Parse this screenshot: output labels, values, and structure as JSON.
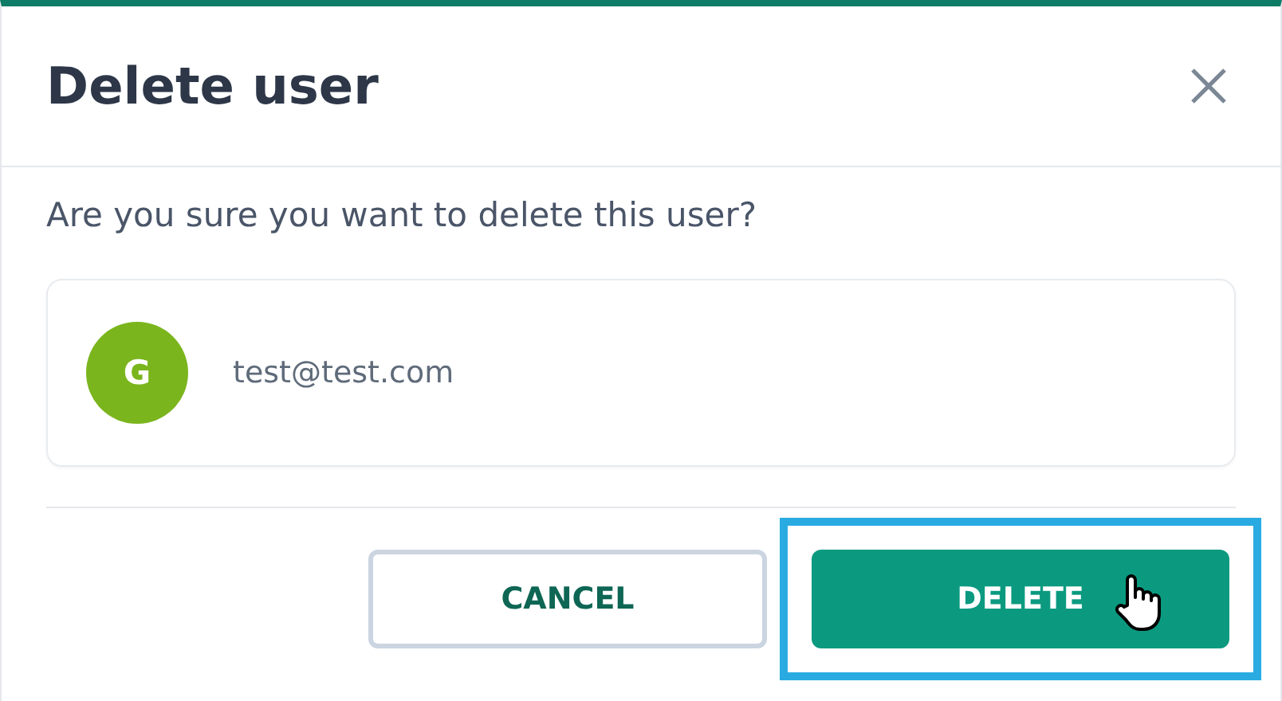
{
  "dialog": {
    "title": "Delete user",
    "message": "Are you sure you want to delete this user?"
  },
  "user": {
    "initial": "G",
    "email": "test@test.com"
  },
  "buttons": [
    {
      "label": "CANCEL",
      "kind": "secondary",
      "highlighted": false
    },
    {
      "label": "DELETE",
      "kind": "primary",
      "highlighted": true
    }
  ]
}
